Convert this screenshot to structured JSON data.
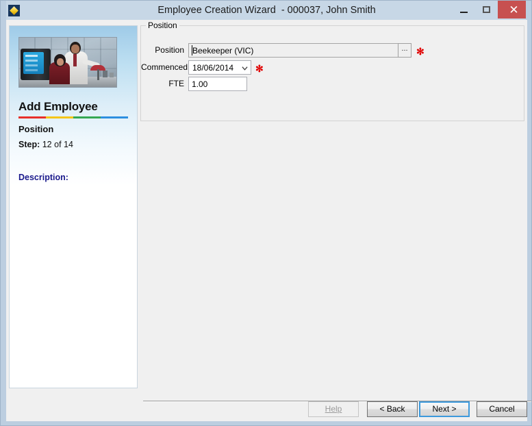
{
  "window": {
    "title": "Employee Creation Wizard  - 000037, John Smith",
    "app_icon": "diamond-logo-icon",
    "controls": {
      "minimize": "–",
      "maximize": "☐",
      "close": "✕"
    }
  },
  "sidebar": {
    "photo_alt": "office-workers-photo",
    "title": "Add Employee",
    "rule_colors": [
      "#e8302a",
      "#f5c518",
      "#34a853",
      "#2d8fe0"
    ],
    "step_name": "Position",
    "step_label": "Step:",
    "step_value": "12 of 14",
    "description_label": "Description:",
    "description_text": ""
  },
  "content": {
    "groupbox": {
      "legend": "Position"
    },
    "fields": {
      "position": {
        "label": "Position",
        "value": "Beekeeper (VIC)",
        "placeholder": "",
        "browse_label": "...",
        "required_marker": "✻"
      },
      "commenced": {
        "label": "Commenced",
        "value": "18/06/2014",
        "required_marker": "✻"
      },
      "fte": {
        "label": "FTE",
        "value": "1.00",
        "placeholder": ""
      }
    }
  },
  "footer": {
    "help": "Help",
    "back": "< Back",
    "next": "Next >",
    "cancel": "Cancel"
  },
  "colors": {
    "titlebar": "#c7d7e6",
    "frame": "#bccee0",
    "close_button": "#c75050",
    "required_star": "#e00000",
    "description": "#1a1a8c",
    "focus_border": "#3c99dc"
  }
}
